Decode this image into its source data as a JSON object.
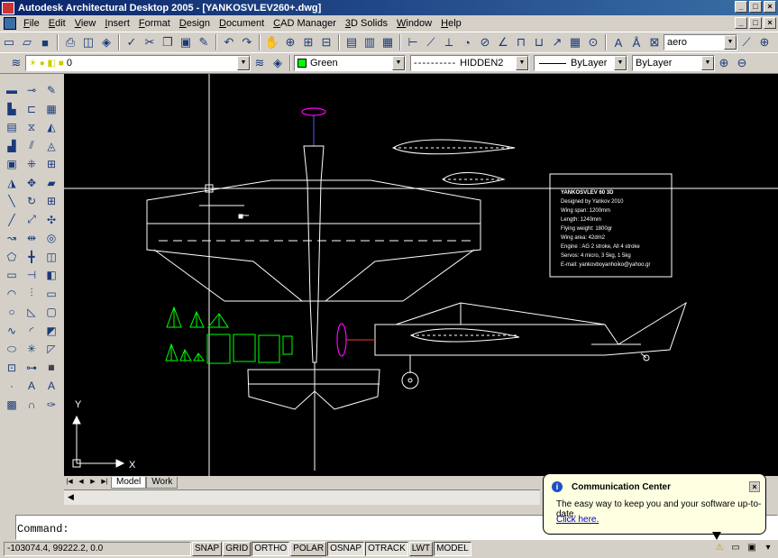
{
  "window": {
    "title": "Autodesk Architectural Desktop 2005 - [YANKOSVLEV260+.dwg]"
  },
  "menu": {
    "items": [
      "File",
      "Edit",
      "View",
      "Insert",
      "Format",
      "Design",
      "Document",
      "CAD Manager",
      "3D Solids",
      "Window",
      "Help"
    ]
  },
  "toolbar": {
    "text_style": "aero",
    "layer": "0",
    "color": "Green",
    "linetype": "HIDDEN2",
    "lineweight": "ByLayer",
    "plotstyle": "ByLayer"
  },
  "colors": {
    "canvas": "#000000",
    "green": "#00ff00",
    "magenta": "#ff00ff",
    "white": "#ffffff"
  },
  "drawing": {
    "info_lines": [
      "YANKOSVLEV 60 3D",
      "Designed by Yankov 2010",
      "Wing span: 1200mm",
      "Length: 1240mm",
      "Flying weight: 1800gr",
      "Wing area: 42dm2",
      "Engine : AG 2 stroke, All 4 stroke",
      "Servos: 4 micro, 3 5kg, 1 5kg",
      "E-mail: yankovboyanhoiko@yahoo.gr"
    ],
    "ucs_y": "Y",
    "ucs_x": "X"
  },
  "layout_tabs": [
    "Model",
    "Work"
  ],
  "command": {
    "prompt": "Command:"
  },
  "status": {
    "coords": "-103074.4, 99222.2, 0.0",
    "toggles": [
      "SNAP",
      "GRID",
      "ORTHO",
      "POLAR",
      "OSNAP",
      "OTRACK",
      "LWT",
      "MODEL"
    ]
  },
  "comm_center": {
    "title": "Communication Center",
    "message": "The easy way to keep you and your software up-to-date.",
    "link": "Click here."
  }
}
